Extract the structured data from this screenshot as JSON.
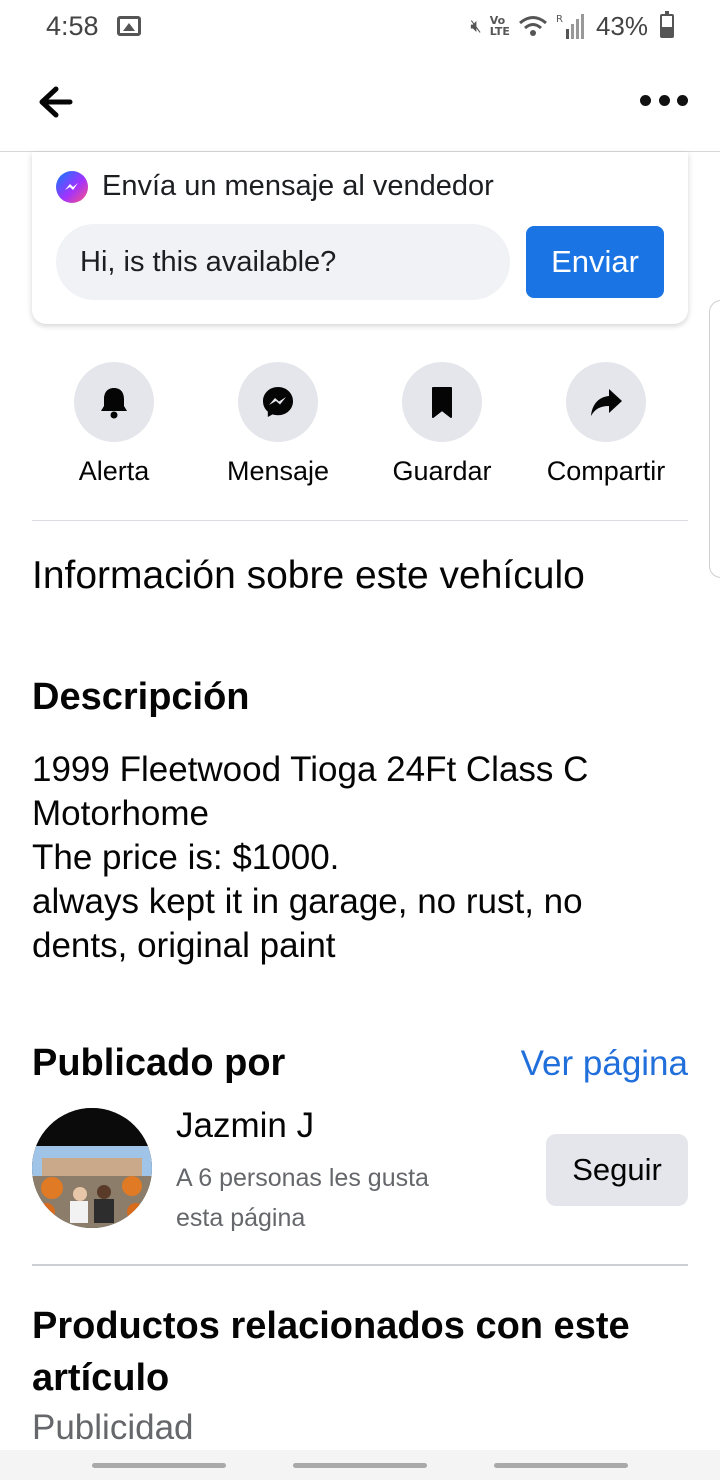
{
  "status_bar": {
    "time": "4:58",
    "battery": "43%",
    "battery_level": 0.43,
    "icons": [
      "gallery-icon",
      "mute-icon",
      "volte-icon",
      "wifi-icon",
      "signal-icon",
      "battery-icon"
    ]
  },
  "nav": {
    "back_icon": "arrow-left-icon",
    "more_icon": "more-horizontal-icon"
  },
  "message_card": {
    "title": "Envía un mensaje al vendedor",
    "input_value": "Hi, is this available?",
    "send_label": "Enviar"
  },
  "actions": [
    {
      "label": "Alerta",
      "icon": "bell-icon"
    },
    {
      "label": "Mensaje",
      "icon": "messenger-icon"
    },
    {
      "label": "Guardar",
      "icon": "bookmark-icon"
    },
    {
      "label": "Compartir",
      "icon": "share-icon"
    }
  ],
  "vehicle_info": "Información sobre este vehículo",
  "description": {
    "heading": "Descripción",
    "lines": [
      "1999 Fleetwood Tioga 24Ft Class C",
      "Motorhome",
      "The price is: $1000.",
      "always kept it in garage, no rust, no",
      "dents, original paint"
    ]
  },
  "posted_by": {
    "heading": "Publicado por",
    "view_page": "Ver página",
    "seller_name": "Jazmin J",
    "likes_line1": "A 6 personas les gusta",
    "likes_line2": "esta página",
    "follow_label": "Seguir"
  },
  "related": {
    "heading": "Productos relacionados con este artículo",
    "sponsored": "Publicidad"
  },
  "colors": {
    "accent": "#1b74e4",
    "link": "#216fdb",
    "button_bg": "#e4e6eb",
    "input_bg": "#f0f2f5",
    "secondary_text": "#65676b"
  }
}
